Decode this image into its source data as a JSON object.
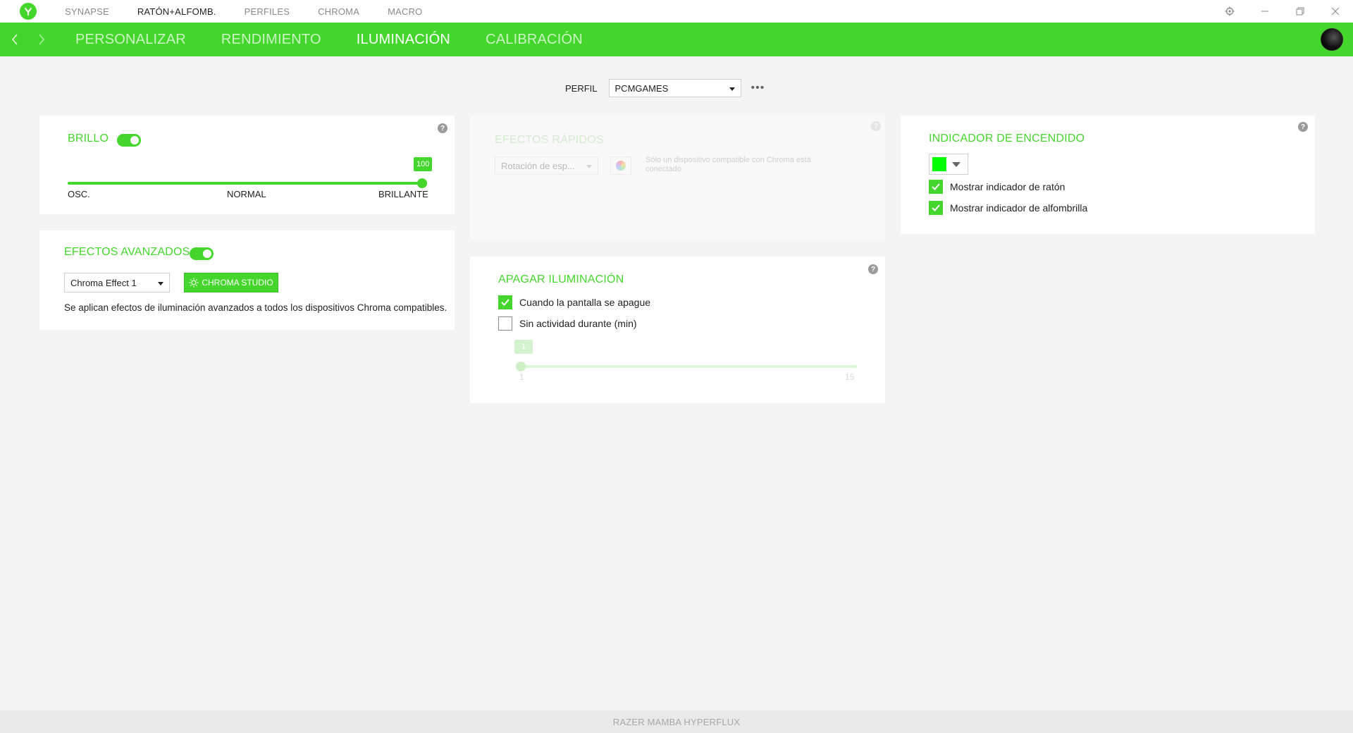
{
  "titlebar": {
    "nav": [
      "SYNAPSE",
      "RATÓN+ALFOMB.",
      "PERFILES",
      "CHROMA",
      "MACRO"
    ],
    "active_nav": "RATÓN+ALFOMB."
  },
  "header": {
    "tabs": [
      "PERSONALIZAR",
      "RENDIMIENTO",
      "ILUMINACIÓN",
      "CALIBRACIÓN"
    ],
    "active_tab": "ILUMINACIÓN"
  },
  "profile": {
    "label": "PERFIL",
    "value": "PCMGAMES",
    "more": "•••"
  },
  "brightness": {
    "title": "BRILLO",
    "enabled": true,
    "value": "100",
    "value_fraction": 1.0,
    "labels": {
      "low": "OSC.",
      "mid": "NORMAL",
      "high": "BRILLANTE"
    }
  },
  "quick_effects": {
    "title": "EFECTOS RÁPIDOS",
    "select_value": "Rotación de esp...",
    "note": "Sólo un dispositivo compatible con Chroma está conectado"
  },
  "power_indicator": {
    "title": "INDICADOR DE ENCENDIDO",
    "color": "#00ff00",
    "options": [
      {
        "label": "Mostrar indicador de ratón",
        "checked": true
      },
      {
        "label": "Mostrar indicador de alfombrilla",
        "checked": true
      }
    ]
  },
  "advanced_effects": {
    "title": "EFECTOS AVANZADOS",
    "enabled": true,
    "select_value": "Chroma Effect 1",
    "button_label": "CHROMA STUDIO",
    "description": "Se aplican efectos de iluminación avanzados a todos los dispositivos Chroma compatibles."
  },
  "lighting_off": {
    "title": "APAGAR ILUMINACIÓN",
    "options": [
      {
        "label": "Cuando la pantalla se apague",
        "checked": true
      },
      {
        "label": "Sin actividad durante (min)",
        "checked": false
      }
    ],
    "slider": {
      "value": "1",
      "min_label": "1",
      "max_label": "15",
      "min": 1,
      "max": 15
    }
  },
  "status_bar": {
    "device": "RAZER MAMBA HYPERFLUX"
  },
  "colors": {
    "accent": "#44d62c",
    "background": "#f4f4f4",
    "card": "#ffffff"
  }
}
